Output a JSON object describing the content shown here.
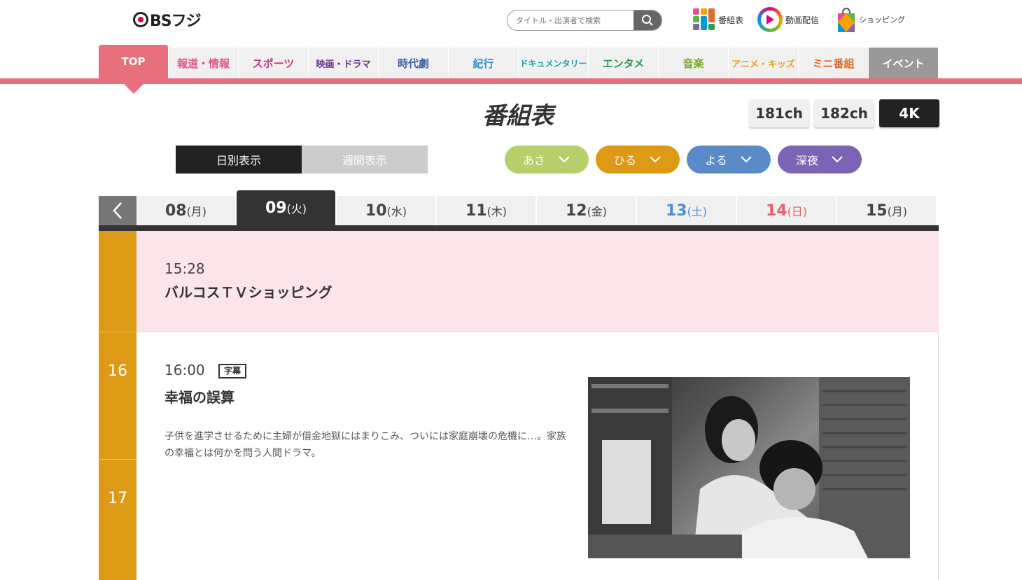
{
  "header": {
    "logo_text": "BSフジ",
    "search_placeholder": "タイトル・出演者で検索",
    "links": [
      {
        "label": "番組表",
        "icon": "grid-icon"
      },
      {
        "label": "動画配信",
        "icon": "play-icon"
      },
      {
        "label": "ショッピング",
        "icon": "shopping-bag-icon"
      }
    ]
  },
  "nav": {
    "tabs": [
      {
        "label": "TOP",
        "color": "#ffffff"
      },
      {
        "label": "報道・情報",
        "color": "#e4518a"
      },
      {
        "label": "スポーツ",
        "color": "#c03a7e"
      },
      {
        "label": "映画・ドラマ",
        "color": "#6b2f86"
      },
      {
        "label": "時代劇",
        "color": "#3d62a8"
      },
      {
        "label": "紀行",
        "color": "#2a8fcf"
      },
      {
        "label": "ドキュメンタリー",
        "color": "#1da0a8"
      },
      {
        "label": "エンタメ",
        "color": "#2e9e4f"
      },
      {
        "label": "音楽",
        "color": "#7aaa2a"
      },
      {
        "label": "アニメ・キッズ",
        "color": "#e7a21a"
      },
      {
        "label": "ミニ番組",
        "color": "#e26a2c"
      },
      {
        "label": "イベント",
        "color": "#ffffff"
      }
    ]
  },
  "page": {
    "title": "番組表",
    "channels": [
      "181ch",
      "182ch",
      "4K"
    ],
    "active_channel": "4K",
    "view_modes": [
      "日別表示",
      "週間表示"
    ],
    "active_view": "日別表示",
    "time_filters": [
      {
        "label": "あさ",
        "color": "#b5cf6b"
      },
      {
        "label": "ひる",
        "color": "#dc9a16"
      },
      {
        "label": "よる",
        "color": "#5b8ac9"
      },
      {
        "label": "深夜",
        "color": "#7b64b6"
      }
    ]
  },
  "dates": [
    {
      "day": "08",
      "wd": "(月)",
      "color": "#444444"
    },
    {
      "day": "09",
      "wd": "(火)",
      "color": "#ffffff"
    },
    {
      "day": "10",
      "wd": "(水)",
      "color": "#444444"
    },
    {
      "day": "11",
      "wd": "(木)",
      "color": "#444444"
    },
    {
      "day": "12",
      "wd": "(金)",
      "color": "#444444"
    },
    {
      "day": "13",
      "wd": "(土)",
      "color": "#4a90d6"
    },
    {
      "day": "14",
      "wd": "(日)",
      "color": "#e8606e"
    },
    {
      "day": "15",
      "wd": "(月)",
      "color": "#444444"
    }
  ],
  "active_date_index": 1,
  "hours": [
    "16",
    "17"
  ],
  "programs": [
    {
      "time": "15:28",
      "title": "バルコスＴＶショッピング"
    },
    {
      "time": "16:00",
      "badge": "字幕",
      "title": "幸福の誤算",
      "description": "子供を進学させるために主婦が借金地獄にはまりこみ、ついには家庭崩壊の危機に…。家族の幸福とは何かを問う人間ドラマ。"
    }
  ]
}
